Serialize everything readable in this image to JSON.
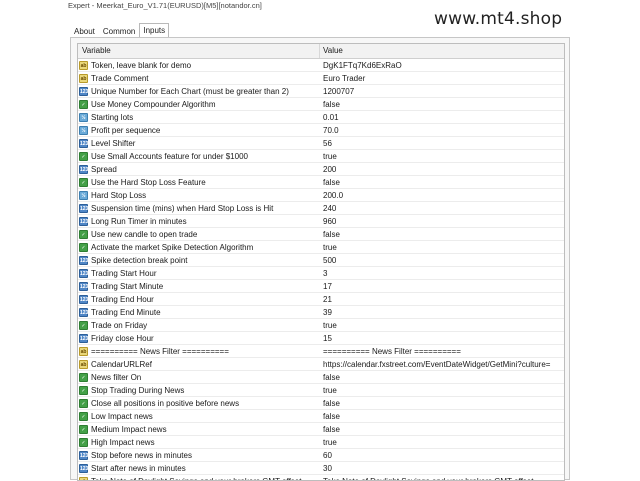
{
  "window": {
    "title": "Expert - Meerkat_Euro_V1.71(EURUSD)[M5][notandor.cn]",
    "watermark": "www.mt4.shop"
  },
  "tabs": [
    {
      "label": "About"
    },
    {
      "label": "Common"
    },
    {
      "label": "Inputs",
      "active": true
    }
  ],
  "table": {
    "columns": {
      "variable": "Variable",
      "value": "Value"
    },
    "rows": [
      {
        "icon": "ab",
        "variable": "Token, leave blank for demo",
        "value": "DgK1FTq7Kd6ExRaO"
      },
      {
        "icon": "ab",
        "variable": "Trade Comment",
        "value": "Euro Trader"
      },
      {
        "icon": "num",
        "variable": "Unique Number for Each Chart (must be greater than 2)",
        "value": "1200707"
      },
      {
        "icon": "bool",
        "variable": "Use Money Compounder Algorithm",
        "value": "false"
      },
      {
        "icon": "dbl",
        "variable": "Starting lots",
        "value": "0.01"
      },
      {
        "icon": "dbl",
        "variable": "Profit per sequence",
        "value": "70.0"
      },
      {
        "icon": "num",
        "variable": "Level Shifter",
        "value": "56"
      },
      {
        "icon": "bool",
        "variable": "Use Small Accounts feature for under $1000",
        "value": "true"
      },
      {
        "icon": "num",
        "variable": "Spread",
        "value": "200"
      },
      {
        "icon": "bool",
        "variable": "Use the Hard Stop Loss Feature",
        "value": "false"
      },
      {
        "icon": "dbl",
        "variable": "Hard Stop Loss",
        "value": "200.0"
      },
      {
        "icon": "num",
        "variable": "Suspension time (mins) when Hard Stop Loss is Hit",
        "value": "240"
      },
      {
        "icon": "num",
        "variable": "Long Run Timer in minutes",
        "value": "960"
      },
      {
        "icon": "bool",
        "variable": "Use new candle to open trade",
        "value": "false"
      },
      {
        "icon": "bool",
        "variable": "Activate the market Spike Detection Algorithm",
        "value": "true"
      },
      {
        "icon": "num",
        "variable": "Spike detection break point",
        "value": "500"
      },
      {
        "icon": "num",
        "variable": "Trading Start Hour",
        "value": "3"
      },
      {
        "icon": "num",
        "variable": "Trading Start Minute",
        "value": "17"
      },
      {
        "icon": "num",
        "variable": "Trading End Hour",
        "value": "21"
      },
      {
        "icon": "num",
        "variable": "Trading End Minute",
        "value": "39"
      },
      {
        "icon": "bool",
        "variable": "Trade on Friday",
        "value": "true"
      },
      {
        "icon": "num",
        "variable": "Friday close Hour",
        "value": "15"
      },
      {
        "icon": "ab",
        "variable": "========== News Filter ==========",
        "value": "========== News Filter =========="
      },
      {
        "icon": "ab",
        "variable": "CalendarURLRef",
        "value": "https://calendar.fxstreet.com/EventDateWidget/GetMini?culture="
      },
      {
        "icon": "bool",
        "variable": "News filter On",
        "value": "false"
      },
      {
        "icon": "bool",
        "variable": "Stop Trading During News",
        "value": "true"
      },
      {
        "icon": "bool",
        "variable": "Close all positions in positive before news",
        "value": "false"
      },
      {
        "icon": "bool",
        "variable": "Low Impact news",
        "value": "false"
      },
      {
        "icon": "bool",
        "variable": "Medium Impact news",
        "value": "false"
      },
      {
        "icon": "bool",
        "variable": "High Impact news",
        "value": "true"
      },
      {
        "icon": "num",
        "variable": "Stop before news in minutes",
        "value": "60"
      },
      {
        "icon": "num",
        "variable": "Start after news in minutes",
        "value": "30"
      },
      {
        "icon": "ab",
        "variable": "Take Note of Daylight Savings and your brokers GMT offset",
        "value": "Take Note of Daylight Savings and your brokers GMT offset"
      }
    ]
  },
  "icon_types": {
    "ab": "string-icon",
    "num": "integer-icon",
    "bool": "boolean-icon",
    "dbl": "double-icon"
  }
}
